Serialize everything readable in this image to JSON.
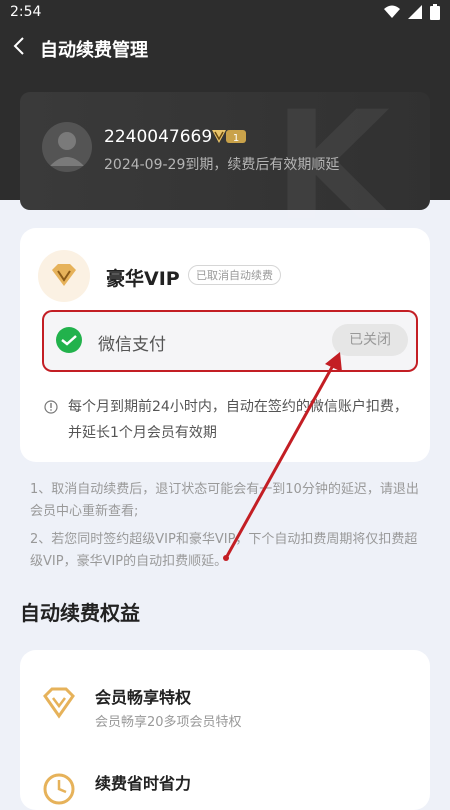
{
  "status": {
    "time": "2:54"
  },
  "nav": {
    "title": "自动续费管理"
  },
  "user": {
    "id": "2240047669",
    "vip_level": "1",
    "expire": "2024-09-29到期，续费后有效期顺延"
  },
  "plan": {
    "title": "豪华VIP",
    "status_badge": "已取消自动续费"
  },
  "payment": {
    "label": "微信支付",
    "button": "已关闭"
  },
  "note": "每个月到期前24小时内，自动在签约的微信账户扣费，并延长1个月会员有效期",
  "tips": [
    "1、取消自动续费后，退订状态可能会有一到10分钟的延迟，请退出会员中心重新查看;",
    "2、若您同时签约超级VIP和豪华VIP，下个自动扣费周期将仅扣费超级VIP，豪华VIP的自动扣费顺延。"
  ],
  "benefits_title": "自动续费权益",
  "benefits": [
    {
      "title": "会员畅享特权",
      "desc": "会员畅享20多项会员特权"
    },
    {
      "title": "续费省时省力",
      "desc": ""
    }
  ],
  "colors": {
    "highlight": "#c31e24",
    "header": "#2d2d2d"
  }
}
